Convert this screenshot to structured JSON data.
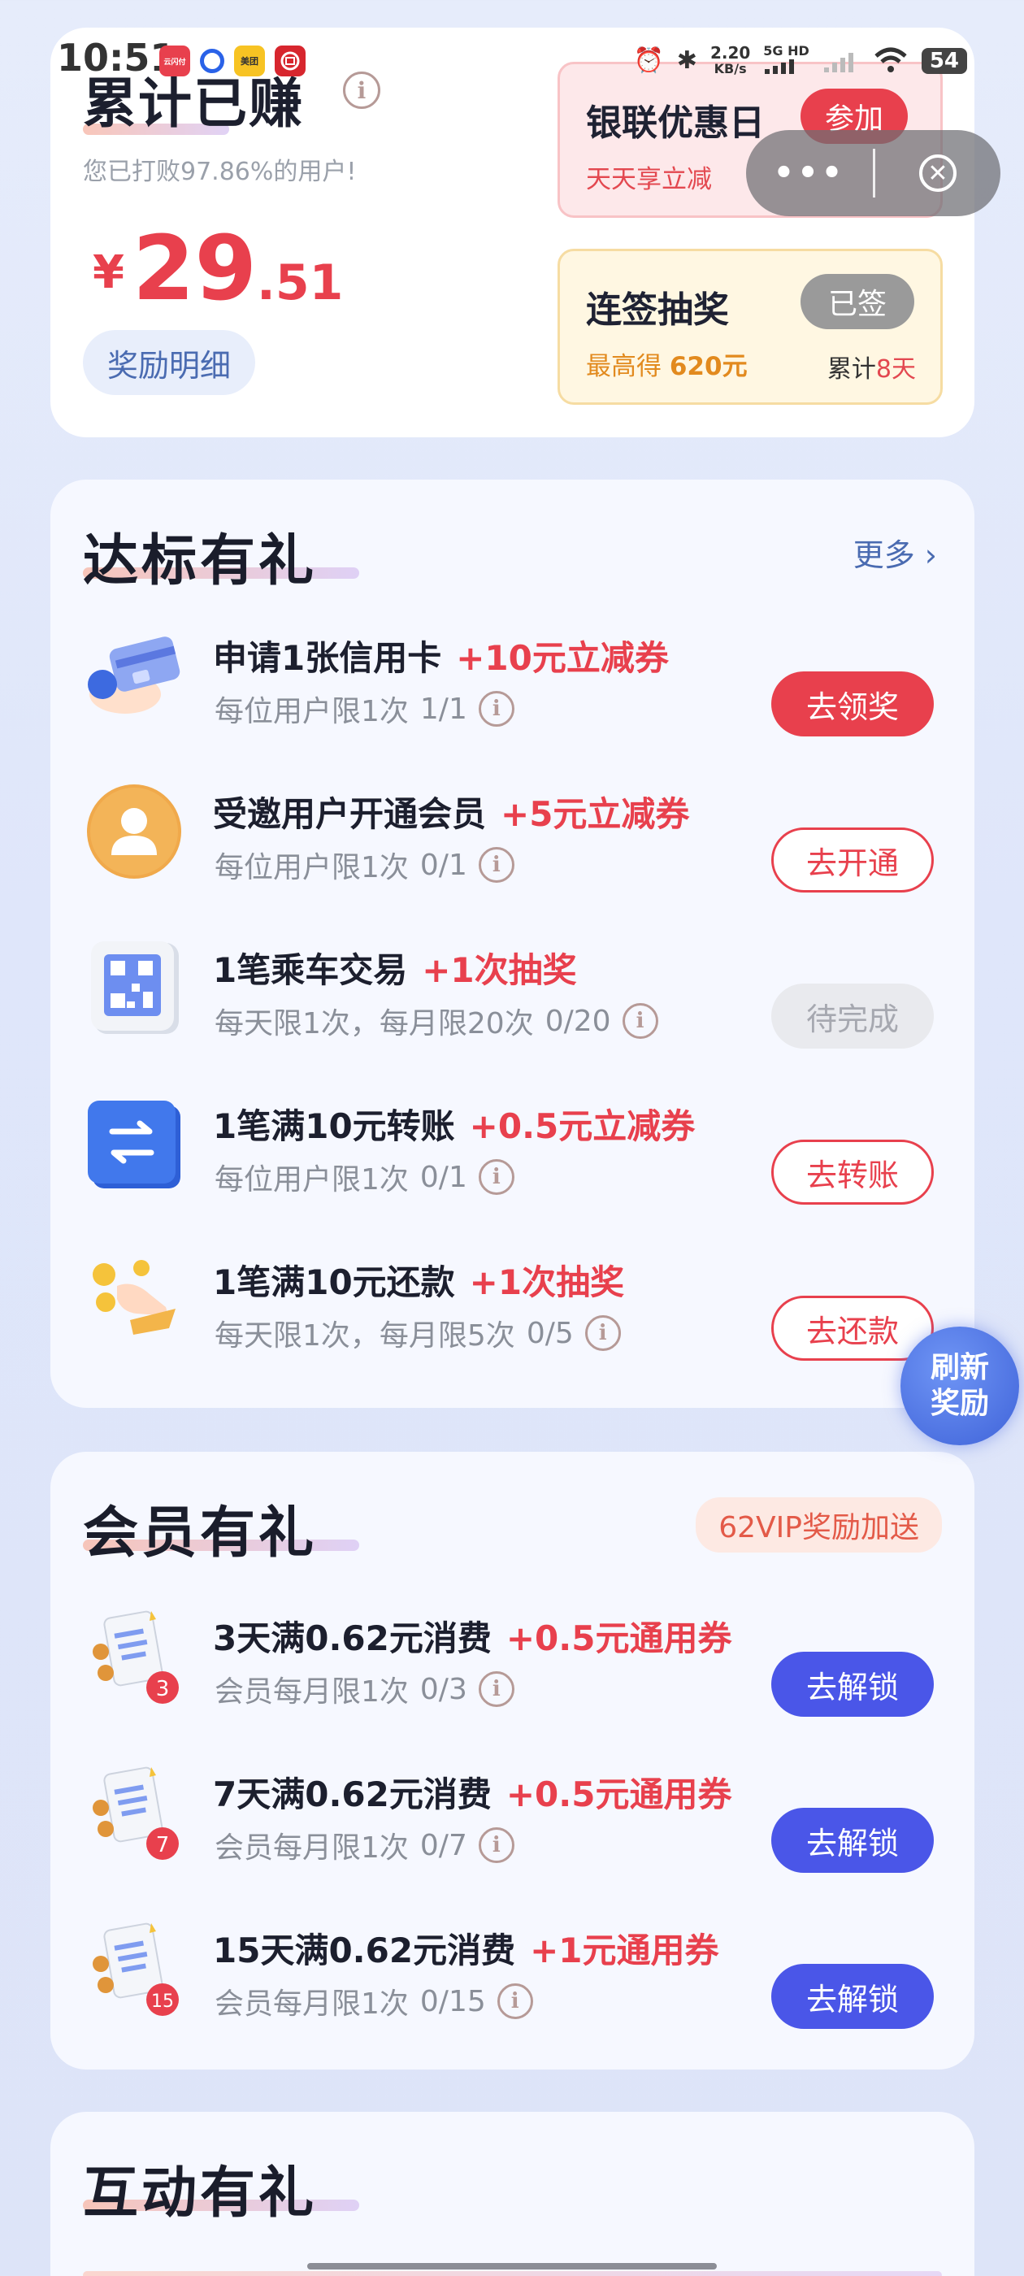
{
  "status_bar": {
    "time": "10:51",
    "apps": [
      {
        "icon": "alipay-app-icon",
        "label": "云闪付",
        "color": "#e8404d"
      },
      {
        "icon": "blue-dot-app-icon",
        "label": "",
        "color": "#2a62e8"
      },
      {
        "icon": "meituan-app-icon",
        "label": "美团",
        "color": "#f7c323"
      },
      {
        "icon": "red-app-icon",
        "label": "",
        "color": "#d7262e"
      }
    ],
    "speed_top": "2.20",
    "speed_bottom": "KB/s",
    "net_label_top": "5G HD",
    "battery": "54"
  },
  "capsule": {
    "more_icon": "more-dots-icon",
    "close_icon": "close-circle-icon"
  },
  "summary": {
    "title": "累计已赚",
    "beat_text": "您已打败97.86%的用户!",
    "currency": "¥",
    "amount_int": "29",
    "amount_dec": ".51",
    "detail_button": "奖励明细",
    "union_promo": {
      "title": "银联优惠日",
      "subtitle": "天天享立减",
      "button": "参加"
    },
    "sign_promo": {
      "title": "连签抽奖",
      "subtitle_prefix": "最高得",
      "subtitle_value": "620元",
      "button": "已签",
      "cumulative_prefix": "累计",
      "cumulative_value": "8天"
    }
  },
  "target_section": {
    "title": "达标有礼",
    "more": "更多",
    "tasks": [
      {
        "icon": "credit-card-icon",
        "title": "申请1张信用卡",
        "reward": "+10元立减券",
        "limit": "每位用户限1次",
        "progress": "1/1",
        "button": "去领奖",
        "state": "claim"
      },
      {
        "icon": "member-avatar-icon",
        "title": "受邀用户开通会员",
        "reward": "+5元立减券",
        "limit": "每位用户限1次",
        "progress": "0/1",
        "button": "去开通",
        "state": "todo"
      },
      {
        "icon": "qr-code-icon",
        "title": "1笔乘车交易",
        "reward": "+1次抽奖",
        "limit": "每天限1次，每月限20次",
        "progress": "0/20",
        "button": "待完成",
        "state": "pending"
      },
      {
        "icon": "transfer-arrows-icon",
        "title": "1笔满10元转账",
        "reward": "+0.5元立减券",
        "limit": "每位用户限1次",
        "progress": "0/1",
        "button": "去转账",
        "state": "todo"
      },
      {
        "icon": "hand-coins-icon",
        "title": "1笔满10元还款",
        "reward": "+1次抽奖",
        "limit": "每天限1次，每月限5次",
        "progress": "0/5",
        "button": "去还款",
        "state": "todo"
      }
    ]
  },
  "refresh_bubble": {
    "line1": "刷新",
    "line2": "奖励"
  },
  "member_section": {
    "title": "会员有礼",
    "tag": "62VIP奖励加送",
    "tasks": [
      {
        "icon": "receipt-coin-icon",
        "badge": "3",
        "title": "3天满0.62元消费",
        "reward": "+0.5元通用券",
        "limit": "会员每月限1次",
        "progress": "0/3",
        "button": "去解锁"
      },
      {
        "icon": "receipt-coin-icon",
        "badge": "7",
        "title": "7天满0.62元消费",
        "reward": "+0.5元通用券",
        "limit": "会员每月限1次",
        "progress": "0/7",
        "button": "去解锁"
      },
      {
        "icon": "receipt-coin-icon",
        "badge": "15",
        "title": "15天满0.62元消费",
        "reward": "+1元通用券",
        "limit": "会员每月限1次",
        "progress": "0/15",
        "button": "去解锁"
      }
    ]
  },
  "interaction_section": {
    "title": "互动有礼"
  },
  "colors": {
    "accent_red": "#e8404d",
    "accent_blue": "#4a56e8",
    "link_blue": "#4a6bb1"
  }
}
